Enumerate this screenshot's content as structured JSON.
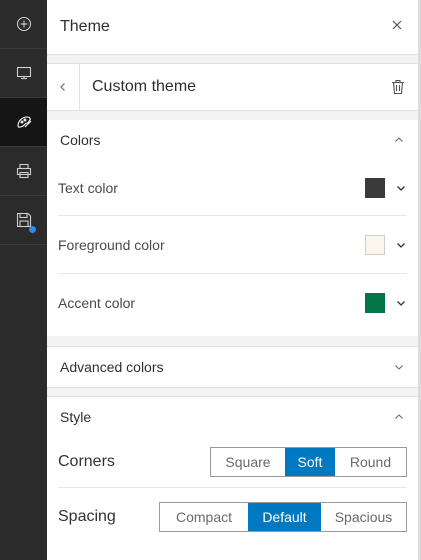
{
  "rail": {
    "items": [
      {
        "icon": "add-circle-icon"
      },
      {
        "icon": "monitor-icon"
      },
      {
        "icon": "palette-icon",
        "active": true
      },
      {
        "icon": "printer-icon"
      },
      {
        "icon": "save-icon",
        "badge": true
      }
    ],
    "badge_color": "#2f8af0"
  },
  "header": {
    "title": "Theme",
    "close_icon": "close-icon"
  },
  "subheader": {
    "title": "Custom theme",
    "back_icon": "chevron-left-icon",
    "delete_icon": "trash-icon"
  },
  "colors_section": {
    "label": "Colors",
    "expanded": true,
    "items": [
      {
        "label": "Text color",
        "value": "#3a3a3a"
      },
      {
        "label": "Foreground color",
        "value": "#fbf6ec"
      },
      {
        "label": "Accent color",
        "value": "#047548"
      }
    ]
  },
  "advanced_section": {
    "label": "Advanced colors",
    "expanded": false
  },
  "style_section": {
    "label": "Style",
    "expanded": true,
    "corners": {
      "label": "Corners",
      "options": [
        "Square",
        "Soft",
        "Round"
      ],
      "selected": "Soft"
    },
    "spacing": {
      "label": "Spacing",
      "options": [
        "Compact",
        "Default",
        "Spacious"
      ],
      "selected": "Default"
    }
  },
  "accent": "#0079c1"
}
